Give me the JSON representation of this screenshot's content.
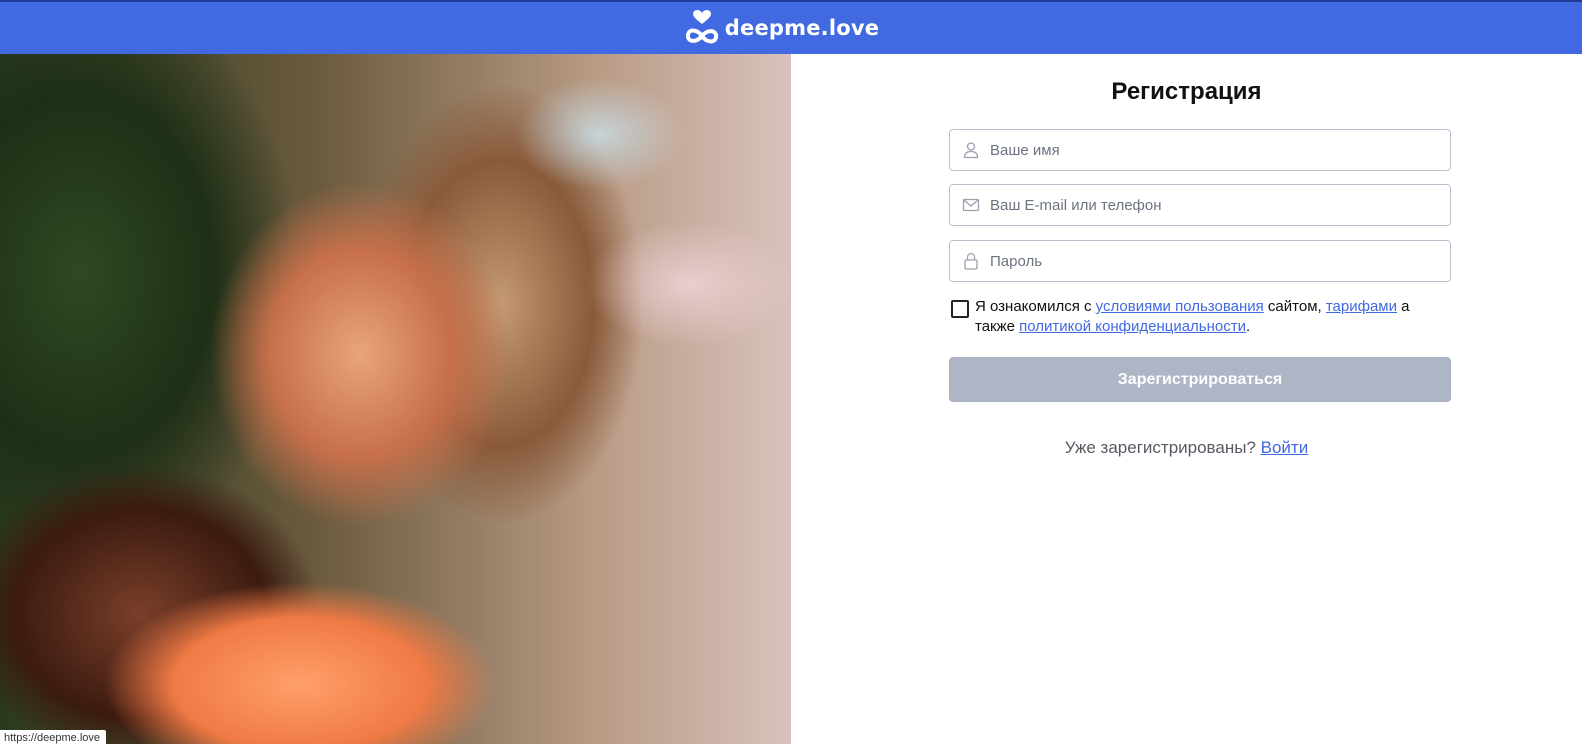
{
  "header": {
    "logo_text": "deepme.love",
    "background_color": "#4169e1"
  },
  "photo": {
    "status_url": "https://deepme.love"
  },
  "form": {
    "title": "Регистрация",
    "name_placeholder": "Ваше имя",
    "name_icon": "user-icon",
    "email_placeholder": "Ваш E-mail или телефон",
    "email_icon": "envelope-icon",
    "password_placeholder": "Пароль",
    "password_icon": "lock-icon",
    "agree": {
      "text_1": "Я ознакомился с ",
      "terms_link": "условиями пользования",
      "text_2": " сайтом, ",
      "tariffs_link": "тарифами",
      "text_3": " а также ",
      "privacy_link": "политикой конфиденциальности",
      "text_4": ".",
      "checked": false
    },
    "submit_label": "Зарегистрироваться",
    "submit_color": "#aeb5c4",
    "login_prompt": "Уже зарегистрированы? ",
    "login_link": "Войти",
    "link_color": "#4169e1"
  }
}
